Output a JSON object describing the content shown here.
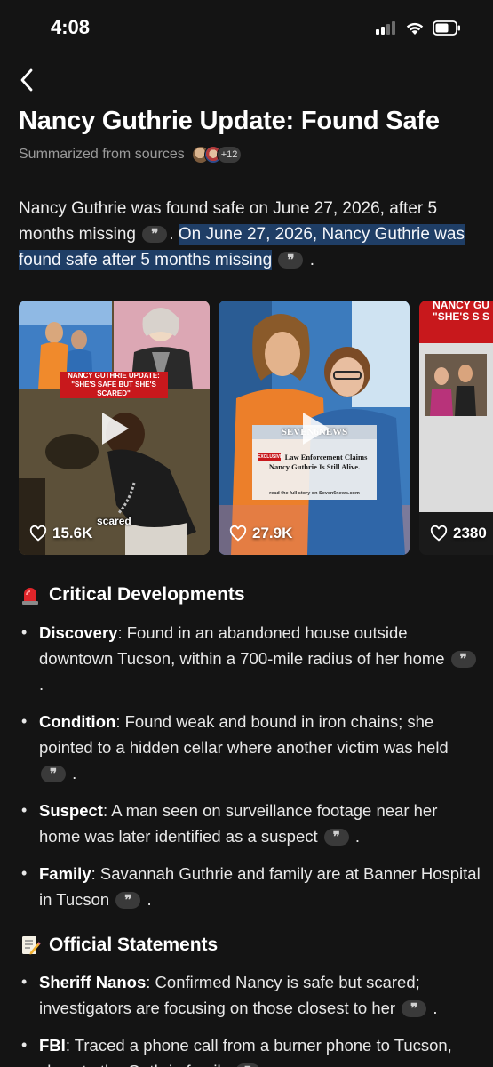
{
  "status": {
    "time": "4:08"
  },
  "page": {
    "title": "Nancy Guthrie Update: Found Safe",
    "sources_label": "Summarized from sources",
    "sources_more": "+12"
  },
  "summary": {
    "part1": "Nancy Guthrie was found safe on June 27, 2026, after 5 months missing",
    "sep": ". ",
    "highlight": "On June 27, 2026, Nancy Guthrie was found safe after 5 months missing",
    "end": "."
  },
  "media": [
    {
      "banner": "NANCY GUTHRIE UPDATE: \"SHE'S SAFE BUT SHE'S SCARED\"",
      "caption": "scared",
      "likes": "15.6K"
    },
    {
      "brand": "SEVEN6NEWS",
      "tag": "EXCLUSIVE",
      "headline": "Law Enforcement Claims Nancy Guthrie Is Still Alive.",
      "footer": "read the full story on Seven6news.com",
      "likes": "27.9K"
    },
    {
      "banner": "NANCY GU \"SHE'S S S",
      "likes": "2380"
    }
  ],
  "sections": {
    "critical": {
      "emoji": "siren-emoji",
      "heading": "Critical Developments",
      "items": [
        {
          "key": "Discovery",
          "text": ": Found in an abandoned house outside downtown Tucson, within a 700-mile radius of her home"
        },
        {
          "key": "Condition",
          "text": ": Found weak and bound in iron chains; she pointed to a hidden cellar where another victim was held"
        },
        {
          "key": "Suspect",
          "text": ": A man seen on surveillance footage near her home was later identified as a suspect"
        },
        {
          "key": "Family",
          "text": ": Savannah Guthrie and family are at Banner Hospital in Tucson"
        }
      ]
    },
    "official": {
      "emoji": "memo-emoji",
      "heading": "Official Statements",
      "items": [
        {
          "key": "Sheriff Nanos",
          "text": ": Confirmed Nancy is safe but scared; investigators are focusing on those closest to her"
        },
        {
          "key": "FBI",
          "text": ": Traced a phone call from a burner phone to Tucson, close to the Guthrie family"
        }
      ]
    }
  },
  "colors": {
    "background": "#141414",
    "highlight": "#1f3e66",
    "citation_chip": "#3a3a3a"
  }
}
